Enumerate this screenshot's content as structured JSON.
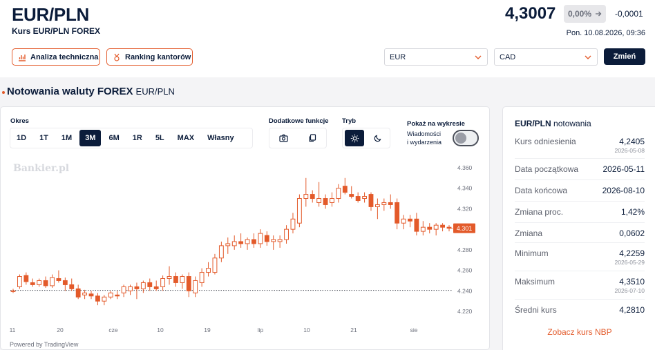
{
  "header": {
    "title": "EUR/PLN",
    "subtitle": "Kurs EUR/PLN FOREX",
    "rate": "4,3007",
    "change_pct": "0,00%",
    "change_abs": "-0,0001",
    "date": "Pon. 10.08.2026, 09:36"
  },
  "actions": {
    "tech_analysis": "Analiza techniczna",
    "ranking": "Ranking kantorów"
  },
  "converter": {
    "from": "EUR",
    "to": "CAD",
    "submit": "Zmień"
  },
  "section": {
    "title": "Notowania waluty FOREX",
    "pair": "EUR/PLN"
  },
  "controls": {
    "period_label": "Okres",
    "periods": [
      "1D",
      "1T",
      "1M",
      "3M",
      "6M",
      "1R",
      "5L",
      "MAX",
      "Własny"
    ],
    "active_period": "3M",
    "extra_label": "Dodatkowe funkcje",
    "mode_label": "Tryb",
    "show_label": "Pokaż na wykresie",
    "toggle_line1": "Wiadomości",
    "toggle_line2": "i wydarzenia",
    "toggle_on": false
  },
  "chart_data": {
    "type": "candlestick",
    "watermark": "Bankier.pl",
    "x_ticks": [
      "11",
      "20",
      "cze",
      "10",
      "19",
      "lip",
      "10",
      "21",
      "sie"
    ],
    "y_ticks": [
      4.36,
      4.34,
      4.32,
      4.3,
      4.28,
      4.26,
      4.24,
      4.22
    ],
    "y_tick_labels": [
      "4.360",
      "4.340",
      "4.320",
      "4.300",
      "4.280",
      "4.260",
      "4.240",
      "4.220"
    ],
    "ylim": [
      4.214,
      4.366
    ],
    "last_value": 4.301,
    "last_label": "4.301",
    "reference_value": 4.2405,
    "colors": {
      "up": "#e35a2a",
      "down": "#e35a2a",
      "last": "#e35a2a"
    },
    "candles": [
      {
        "o": 4.24,
        "h": 4.242,
        "l": 4.238,
        "c": 4.24
      },
      {
        "o": 4.244,
        "h": 4.256,
        "l": 4.242,
        "c": 4.254
      },
      {
        "o": 4.255,
        "h": 4.258,
        "l": 4.246,
        "c": 4.249
      },
      {
        "o": 4.248,
        "h": 4.252,
        "l": 4.244,
        "c": 4.246
      },
      {
        "o": 4.246,
        "h": 4.252,
        "l": 4.244,
        "c": 4.25
      },
      {
        "o": 4.25,
        "h": 4.254,
        "l": 4.243,
        "c": 4.245
      },
      {
        "o": 4.245,
        "h": 4.256,
        "l": 4.243,
        "c": 4.253
      },
      {
        "o": 4.252,
        "h": 4.26,
        "l": 4.248,
        "c": 4.25
      },
      {
        "o": 4.25,
        "h": 4.253,
        "l": 4.24,
        "c": 4.246
      },
      {
        "o": 4.246,
        "h": 4.252,
        "l": 4.24,
        "c": 4.242
      },
      {
        "o": 4.242,
        "h": 4.246,
        "l": 4.232,
        "c": 4.234
      },
      {
        "o": 4.236,
        "h": 4.241,
        "l": 4.232,
        "c": 4.238
      },
      {
        "o": 4.237,
        "h": 4.24,
        "l": 4.232,
        "c": 4.235
      },
      {
        "o": 4.235,
        "h": 4.238,
        "l": 4.226,
        "c": 4.23
      },
      {
        "o": 4.23,
        "h": 4.236,
        "l": 4.226,
        "c": 4.234
      },
      {
        "o": 4.234,
        "h": 4.24,
        "l": 4.232,
        "c": 4.238
      },
      {
        "o": 4.236,
        "h": 4.24,
        "l": 4.232,
        "c": 4.235
      },
      {
        "o": 4.238,
        "h": 4.246,
        "l": 4.234,
        "c": 4.244
      },
      {
        "o": 4.24,
        "h": 4.246,
        "l": 4.236,
        "c": 4.244
      },
      {
        "o": 4.244,
        "h": 4.248,
        "l": 4.232,
        "c": 4.242
      },
      {
        "o": 4.242,
        "h": 4.25,
        "l": 4.238,
        "c": 4.248
      },
      {
        "o": 4.248,
        "h": 4.252,
        "l": 4.24,
        "c": 4.244
      },
      {
        "o": 4.244,
        "h": 4.25,
        "l": 4.24,
        "c": 4.242
      },
      {
        "o": 4.244,
        "h": 4.255,
        "l": 4.24,
        "c": 4.252
      },
      {
        "o": 4.252,
        "h": 4.264,
        "l": 4.246,
        "c": 4.254
      },
      {
        "o": 4.254,
        "h": 4.258,
        "l": 4.244,
        "c": 4.248
      },
      {
        "o": 4.248,
        "h": 4.256,
        "l": 4.242,
        "c": 4.254
      },
      {
        "o": 4.254,
        "h": 4.258,
        "l": 4.234,
        "c": 4.24
      },
      {
        "o": 4.238,
        "h": 4.254,
        "l": 4.234,
        "c": 4.25
      },
      {
        "o": 4.248,
        "h": 4.262,
        "l": 4.244,
        "c": 4.258
      },
      {
        "o": 4.258,
        "h": 4.268,
        "l": 4.254,
        "c": 4.262
      },
      {
        "o": 4.258,
        "h": 4.276,
        "l": 4.256,
        "c": 4.272
      },
      {
        "o": 4.272,
        "h": 4.288,
        "l": 4.268,
        "c": 4.284
      },
      {
        "o": 4.284,
        "h": 4.292,
        "l": 4.276,
        "c": 4.286
      },
      {
        "o": 4.284,
        "h": 4.294,
        "l": 4.28,
        "c": 4.288
      },
      {
        "o": 4.288,
        "h": 4.296,
        "l": 4.282,
        "c": 4.286
      },
      {
        "o": 4.286,
        "h": 4.292,
        "l": 4.28,
        "c": 4.29
      },
      {
        "o": 4.29,
        "h": 4.296,
        "l": 4.282,
        "c": 4.286
      },
      {
        "o": 4.286,
        "h": 4.3,
        "l": 4.282,
        "c": 4.296
      },
      {
        "o": 4.294,
        "h": 4.298,
        "l": 4.284,
        "c": 4.288
      },
      {
        "o": 4.288,
        "h": 4.294,
        "l": 4.28,
        "c": 4.29
      },
      {
        "o": 4.288,
        "h": 4.294,
        "l": 4.282,
        "c": 4.29
      },
      {
        "o": 4.29,
        "h": 4.304,
        "l": 4.286,
        "c": 4.3
      },
      {
        "o": 4.3,
        "h": 4.316,
        "l": 4.296,
        "c": 4.31
      },
      {
        "o": 4.306,
        "h": 4.334,
        "l": 4.302,
        "c": 4.33
      },
      {
        "o": 4.33,
        "h": 4.35,
        "l": 4.322,
        "c": 4.334
      },
      {
        "o": 4.334,
        "h": 4.338,
        "l": 4.326,
        "c": 4.33
      },
      {
        "o": 4.326,
        "h": 4.346,
        "l": 4.322,
        "c": 4.33
      },
      {
        "o": 4.33,
        "h": 4.334,
        "l": 4.32,
        "c": 4.324
      },
      {
        "o": 4.326,
        "h": 4.336,
        "l": 4.322,
        "c": 4.33
      },
      {
        "o": 4.33,
        "h": 4.344,
        "l": 4.326,
        "c": 4.34
      },
      {
        "o": 4.342,
        "h": 4.35,
        "l": 4.334,
        "c": 4.336
      },
      {
        "o": 4.334,
        "h": 4.342,
        "l": 4.33,
        "c": 4.332
      },
      {
        "o": 4.332,
        "h": 4.336,
        "l": 4.326,
        "c": 4.328
      },
      {
        "o": 4.33,
        "h": 4.336,
        "l": 4.326,
        "c": 4.332
      },
      {
        "o": 4.334,
        "h": 4.336,
        "l": 4.318,
        "c": 4.322
      },
      {
        "o": 4.322,
        "h": 4.33,
        "l": 4.31,
        "c": 4.324
      },
      {
        "o": 4.324,
        "h": 4.33,
        "l": 4.318,
        "c": 4.326
      },
      {
        "o": 4.326,
        "h": 4.334,
        "l": 4.32,
        "c": 4.324
      },
      {
        "o": 4.326,
        "h": 4.33,
        "l": 4.3,
        "c": 4.306
      },
      {
        "o": 4.306,
        "h": 4.314,
        "l": 4.3,
        "c": 4.31
      },
      {
        "o": 4.31,
        "h": 4.314,
        "l": 4.302,
        "c": 4.308
      },
      {
        "o": 4.31,
        "h": 4.316,
        "l": 4.294,
        "c": 4.298
      },
      {
        "o": 4.298,
        "h": 4.308,
        "l": 4.294,
        "c": 4.302
      },
      {
        "o": 4.302,
        "h": 4.306,
        "l": 4.296,
        "c": 4.3
      },
      {
        "o": 4.3,
        "h": 4.306,
        "l": 4.294,
        "c": 4.304
      },
      {
        "o": 4.304,
        "h": 4.306,
        "l": 4.298,
        "c": 4.302
      },
      {
        "o": 4.302,
        "h": 4.304,
        "l": 4.298,
        "c": 4.301
      }
    ]
  },
  "chart_footer": "Powered by TradingView",
  "quote": {
    "pair": "EUR/PLN",
    "title_suffix": "notowania",
    "rows": [
      {
        "label": "Kurs odniesienia",
        "value": "4,2405",
        "date": "2026-05-08"
      },
      {
        "label": "Data początkowa",
        "value": "2026-05-11",
        "date": ""
      },
      {
        "label": "Data końcowa",
        "value": "2026-08-10",
        "date": ""
      },
      {
        "label": "Zmiana proc.",
        "value": "1,42%",
        "date": ""
      },
      {
        "label": "Zmiana",
        "value": "0,0602",
        "date": ""
      },
      {
        "label": "Minimum",
        "value": "4,2259",
        "date": "2026-05-29"
      },
      {
        "label": "Maksimum",
        "value": "4,3510",
        "date": "2026-07-10"
      },
      {
        "label": "Średni kurs",
        "value": "4,2810",
        "date": ""
      }
    ],
    "nbp_link": "Zobacz kurs NBP"
  }
}
